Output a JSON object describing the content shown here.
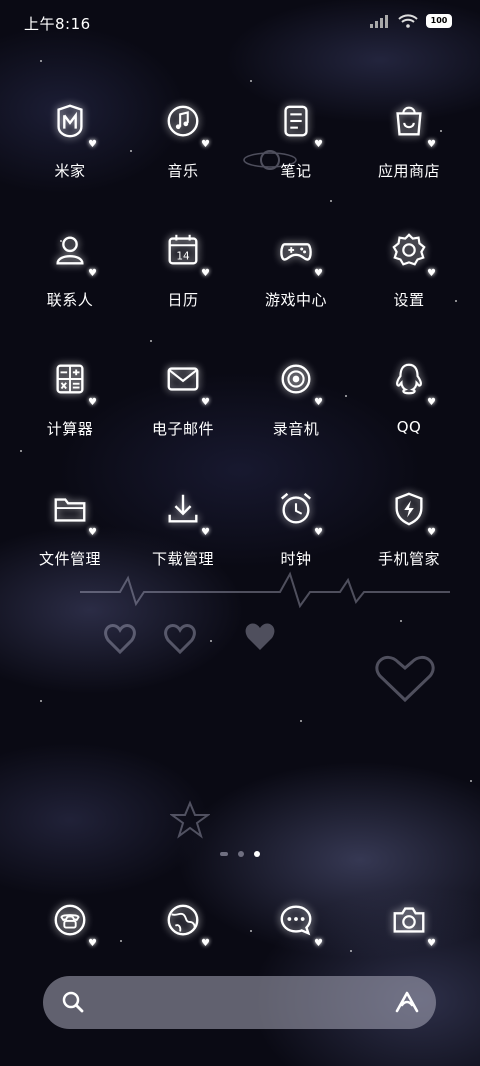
{
  "status_bar": {
    "time": "上午8:16",
    "battery": "100"
  },
  "apps": [
    {
      "label": "米家",
      "icon": "mijia-icon"
    },
    {
      "label": "音乐",
      "icon": "music-icon"
    },
    {
      "label": "笔记",
      "icon": "notes-icon"
    },
    {
      "label": "应用商店",
      "icon": "app-store-icon"
    },
    {
      "label": "联系人",
      "icon": "contacts-icon"
    },
    {
      "label": "日历",
      "icon": "calendar-icon",
      "badge": "14"
    },
    {
      "label": "游戏中心",
      "icon": "gamepad-icon"
    },
    {
      "label": "设置",
      "icon": "gear-icon"
    },
    {
      "label": "计算器",
      "icon": "calculator-icon"
    },
    {
      "label": "电子邮件",
      "icon": "mail-icon"
    },
    {
      "label": "录音机",
      "icon": "recorder-icon"
    },
    {
      "label": "QQ",
      "icon": "qq-icon"
    },
    {
      "label": "文件管理",
      "icon": "folder-icon"
    },
    {
      "label": "下载管理",
      "icon": "download-icon"
    },
    {
      "label": "时钟",
      "icon": "alarm-clock-icon"
    },
    {
      "label": "手机管家",
      "icon": "shield-icon"
    }
  ],
  "dock": [
    {
      "name": "phone",
      "icon": "phone-icon"
    },
    {
      "name": "browser",
      "icon": "globe-icon"
    },
    {
      "name": "messages",
      "icon": "message-icon"
    },
    {
      "name": "camera",
      "icon": "camera-icon"
    }
  ],
  "page_indicator": {
    "pages": 3,
    "active": 3
  },
  "colors": {
    "background": "#0a0a14",
    "text": "#ffffff",
    "search_bar": "#aaaab9"
  }
}
